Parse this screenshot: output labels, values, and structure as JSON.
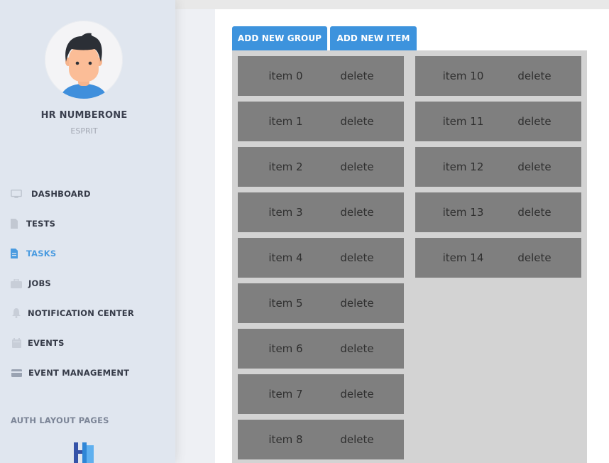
{
  "user": {
    "name": "HR NUMBERONE",
    "org": "ESPRIT"
  },
  "nav": {
    "items": [
      {
        "label": "DASHBOARD",
        "icon": "monitor-icon",
        "active": false
      },
      {
        "label": "TESTS",
        "icon": "document-icon",
        "active": false
      },
      {
        "label": "TASKS",
        "icon": "document-icon",
        "active": true
      },
      {
        "label": "JOBS",
        "icon": "briefcase-icon",
        "active": false
      },
      {
        "label": "NOTIFICATION CENTER",
        "icon": "bell-icon",
        "active": false
      },
      {
        "label": "EVENTS",
        "icon": "calendar-icon",
        "active": false
      },
      {
        "label": "EVENT MANAGEMENT",
        "icon": "card-icon",
        "active": false
      }
    ],
    "section_title": "AUTH LAYOUT PAGES"
  },
  "toolbar": {
    "add_group_label": "ADD NEW GROUP",
    "add_item_label": "ADD NEW ITEM"
  },
  "groups": [
    {
      "items": [
        {
          "label": "item 0",
          "delete_label": "delete"
        },
        {
          "label": "item 1",
          "delete_label": "delete"
        },
        {
          "label": "item 2",
          "delete_label": "delete"
        },
        {
          "label": "item 3",
          "delete_label": "delete"
        },
        {
          "label": "item 4",
          "delete_label": "delete"
        },
        {
          "label": "item 5",
          "delete_label": "delete"
        },
        {
          "label": "item 6",
          "delete_label": "delete"
        },
        {
          "label": "item 7",
          "delete_label": "delete"
        },
        {
          "label": "item 8",
          "delete_label": "delete"
        }
      ]
    },
    {
      "items": [
        {
          "label": "item 10",
          "delete_label": "delete"
        },
        {
          "label": "item 11",
          "delete_label": "delete"
        },
        {
          "label": "item 12",
          "delete_label": "delete"
        },
        {
          "label": "item 13",
          "delete_label": "delete"
        },
        {
          "label": "item 14",
          "delete_label": "delete"
        }
      ]
    }
  ],
  "colors": {
    "accent": "#3d93dd",
    "active_nav": "#4a9be0",
    "item_bg": "#7f7f7f",
    "board_bg": "#d3d3d3",
    "sidebar_bg": "#e0e6ef"
  }
}
